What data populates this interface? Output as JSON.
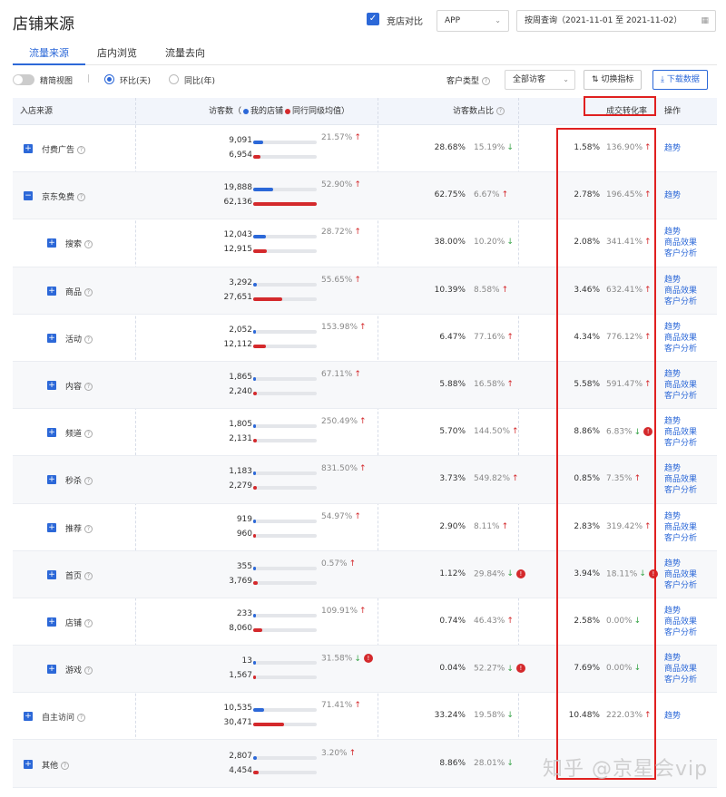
{
  "header": {
    "title": "店铺来源",
    "compare_label": "竞店对比",
    "platform": "APP",
    "date_range": "按周查询（2021-11-01 至 2021-11-02）"
  },
  "tabs": [
    "流量来源",
    "店内浏览",
    "流量去向"
  ],
  "toolbar": {
    "simple_view": "精简视图",
    "separator": "|",
    "ring_label": "环比(天)",
    "yoy_label": "同比(年)",
    "customer_type_label": "客户类型",
    "customer_type_value": "全部访客",
    "switch_metric": "切换指标",
    "download": "下载数据"
  },
  "table": {
    "headers": {
      "source": "入店来源",
      "visitors_prefix": "访客数（",
      "my_store": "我的店铺",
      "peer_avg": "同行同级均值",
      "visitors_suffix": "）",
      "share": "访客数占比",
      "conversion": "成交转化率",
      "ops": "操作"
    },
    "colors": {
      "my": "#2c68d8",
      "peer": "#d4292c",
      "up": "#d4292c",
      "down": "#3aa54a"
    },
    "ops_labels": {
      "trend": "趋势",
      "product": "商品效果",
      "customer": "客户分析"
    },
    "rows": [
      {
        "name": "付费广告",
        "expander": "+",
        "level": 0,
        "mine": "9,091",
        "peer": "6,954",
        "mine_frac": 0.15,
        "peer_frac": 0.11,
        "chg": "21.57%",
        "chg_dir": "up",
        "chg_warn": false,
        "share": "28.68%",
        "share_chg": "15.19%",
        "share_dir": "down",
        "share_warn": false,
        "conv": "1.58%",
        "conv_chg": "136.90%",
        "conv_dir": "up",
        "conv_warn": false,
        "ops": [
          "趋势"
        ]
      },
      {
        "name": "京东免费",
        "expander": "−",
        "level": 0,
        "mine": "19,888",
        "peer": "62,136",
        "mine_frac": 0.32,
        "peer_frac": 1.0,
        "chg": "52.90%",
        "chg_dir": "up",
        "chg_warn": false,
        "share": "62.75%",
        "share_chg": "6.67%",
        "share_dir": "up",
        "share_warn": false,
        "conv": "2.78%",
        "conv_chg": "196.45%",
        "conv_dir": "up",
        "conv_warn": false,
        "ops": [
          "趋势"
        ]
      },
      {
        "name": "搜索",
        "expander": "+",
        "level": 1,
        "mine": "12,043",
        "peer": "12,915",
        "mine_frac": 0.2,
        "peer_frac": 0.21,
        "chg": "28.72%",
        "chg_dir": "up",
        "chg_warn": false,
        "share": "38.00%",
        "share_chg": "10.20%",
        "share_dir": "down",
        "share_warn": false,
        "conv": "2.08%",
        "conv_chg": "341.41%",
        "conv_dir": "up",
        "conv_warn": false,
        "ops": [
          "趋势",
          "商品效果",
          "客户分析"
        ]
      },
      {
        "name": "商品",
        "expander": "+",
        "level": 1,
        "mine": "3,292",
        "peer": "27,651",
        "mine_frac": 0.06,
        "peer_frac": 0.45,
        "chg": "55.65%",
        "chg_dir": "up",
        "chg_warn": false,
        "share": "10.39%",
        "share_chg": "8.58%",
        "share_dir": "up",
        "share_warn": false,
        "conv": "3.46%",
        "conv_chg": "632.41%",
        "conv_dir": "up",
        "conv_warn": false,
        "ops": [
          "趋势",
          "商品效果",
          "客户分析"
        ]
      },
      {
        "name": "活动",
        "expander": "+",
        "level": 1,
        "mine": "2,052",
        "peer": "12,112",
        "mine_frac": 0.04,
        "peer_frac": 0.2,
        "chg": "153.98%",
        "chg_dir": "up",
        "chg_warn": false,
        "share": "6.47%",
        "share_chg": "77.16%",
        "share_dir": "up",
        "share_warn": false,
        "conv": "4.34%",
        "conv_chg": "776.12%",
        "conv_dir": "up",
        "conv_warn": false,
        "ops": [
          "趋势",
          "商品效果",
          "客户分析"
        ]
      },
      {
        "name": "内容",
        "expander": "+",
        "level": 1,
        "mine": "1,865",
        "peer": "2,240",
        "mine_frac": 0.04,
        "peer_frac": 0.05,
        "chg": "67.11%",
        "chg_dir": "up",
        "chg_warn": false,
        "share": "5.88%",
        "share_chg": "16.58%",
        "share_dir": "up",
        "share_warn": false,
        "conv": "5.58%",
        "conv_chg": "591.47%",
        "conv_dir": "up",
        "conv_warn": false,
        "ops": [
          "趋势",
          "商品效果",
          "客户分析"
        ]
      },
      {
        "name": "频道",
        "expander": "+",
        "level": 1,
        "mine": "1,805",
        "peer": "2,131",
        "mine_frac": 0.04,
        "peer_frac": 0.05,
        "chg": "250.49%",
        "chg_dir": "up",
        "chg_warn": false,
        "share": "5.70%",
        "share_chg": "144.50%",
        "share_dir": "up",
        "share_warn": false,
        "conv": "8.86%",
        "conv_chg": "6.83%",
        "conv_dir": "down",
        "conv_warn": true,
        "ops": [
          "趋势",
          "商品效果",
          "客户分析"
        ]
      },
      {
        "name": "秒杀",
        "expander": "+",
        "level": 1,
        "mine": "1,183",
        "peer": "2,279",
        "mine_frac": 0.03,
        "peer_frac": 0.05,
        "chg": "831.50%",
        "chg_dir": "up",
        "chg_warn": false,
        "share": "3.73%",
        "share_chg": "549.82%",
        "share_dir": "up",
        "share_warn": false,
        "conv": "0.85%",
        "conv_chg": "7.35%",
        "conv_dir": "up",
        "conv_warn": false,
        "ops": [
          "趋势",
          "商品效果",
          "客户分析"
        ]
      },
      {
        "name": "推荐",
        "expander": "+",
        "level": 1,
        "mine": "919",
        "peer": "960",
        "mine_frac": 0.02,
        "peer_frac": 0.02,
        "chg": "54.97%",
        "chg_dir": "up",
        "chg_warn": false,
        "share": "2.90%",
        "share_chg": "8.11%",
        "share_dir": "up",
        "share_warn": false,
        "conv": "2.83%",
        "conv_chg": "319.42%",
        "conv_dir": "up",
        "conv_warn": false,
        "ops": [
          "趋势",
          "商品效果",
          "客户分析"
        ]
      },
      {
        "name": "首页",
        "expander": "+",
        "level": 1,
        "mine": "355",
        "peer": "3,769",
        "mine_frac": 0.01,
        "peer_frac": 0.07,
        "chg": "0.57%",
        "chg_dir": "up",
        "chg_warn": false,
        "share": "1.12%",
        "share_chg": "29.84%",
        "share_dir": "down",
        "share_warn": true,
        "conv": "3.94%",
        "conv_chg": "18.11%",
        "conv_dir": "down",
        "conv_warn": true,
        "ops": [
          "趋势",
          "商品效果",
          "客户分析"
        ]
      },
      {
        "name": "店铺",
        "expander": "+",
        "level": 1,
        "mine": "233",
        "peer": "8,060",
        "mine_frac": 0.01,
        "peer_frac": 0.14,
        "chg": "109.91%",
        "chg_dir": "up",
        "chg_warn": false,
        "share": "0.74%",
        "share_chg": "46.43%",
        "share_dir": "up",
        "share_warn": false,
        "conv": "2.58%",
        "conv_chg": "0.00%",
        "conv_dir": "down",
        "conv_warn": false,
        "ops": [
          "趋势",
          "商品效果",
          "客户分析"
        ]
      },
      {
        "name": "游戏",
        "expander": "+",
        "level": 1,
        "mine": "13",
        "peer": "1,567",
        "mine_frac": 0.005,
        "peer_frac": 0.03,
        "chg": "31.58%",
        "chg_dir": "down",
        "chg_warn": true,
        "share": "0.04%",
        "share_chg": "52.27%",
        "share_dir": "down",
        "share_warn": true,
        "conv": "7.69%",
        "conv_chg": "0.00%",
        "conv_dir": "down",
        "conv_warn": false,
        "ops": [
          "趋势",
          "商品效果",
          "客户分析"
        ]
      },
      {
        "name": "自主访问",
        "expander": "+",
        "level": 0,
        "mine": "10,535",
        "peer": "30,471",
        "mine_frac": 0.17,
        "peer_frac": 0.49,
        "chg": "71.41%",
        "chg_dir": "up",
        "chg_warn": false,
        "share": "33.24%",
        "share_chg": "19.58%",
        "share_dir": "down",
        "share_warn": false,
        "conv": "10.48%",
        "conv_chg": "222.03%",
        "conv_dir": "up",
        "conv_warn": false,
        "ops": [
          "趋势"
        ]
      },
      {
        "name": "其他",
        "expander": "+",
        "level": 0,
        "mine": "2,807",
        "peer": "4,454",
        "mine_frac": 0.05,
        "peer_frac": 0.08,
        "chg": "3.20%",
        "chg_dir": "up",
        "chg_warn": false,
        "share": "8.86%",
        "share_chg": "28.01%",
        "share_dir": "down",
        "share_warn": false,
        "conv": "",
        "conv_chg": "",
        "conv_dir": "",
        "conv_warn": false,
        "ops": []
      }
    ]
  },
  "watermark": "知乎 @京星会vip"
}
